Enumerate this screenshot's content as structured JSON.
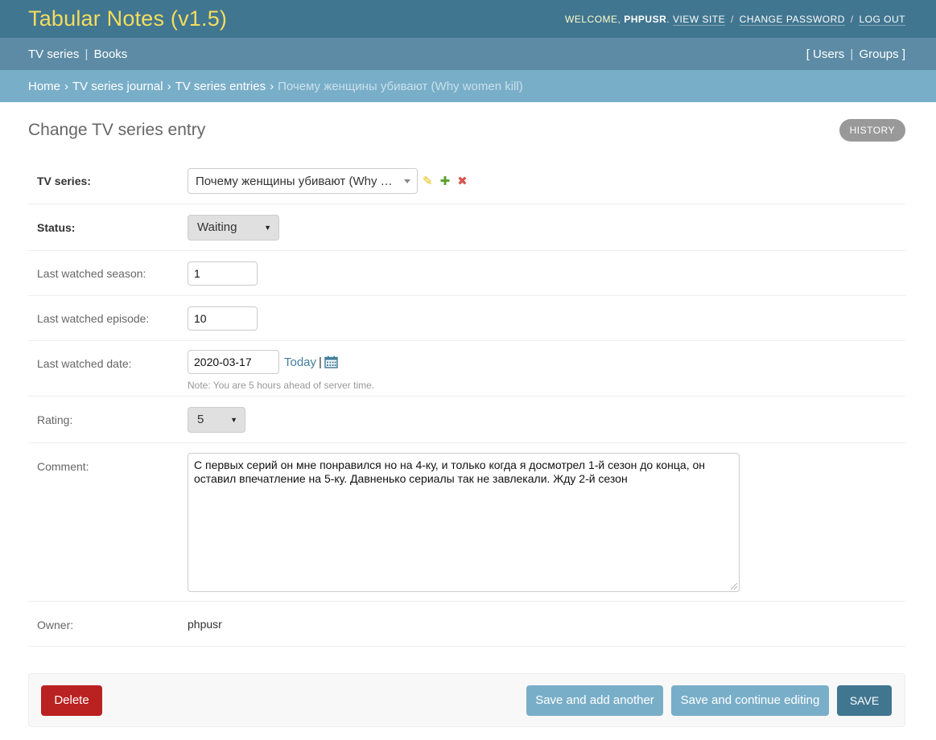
{
  "header": {
    "branding": "Tabular Notes (v1.5)",
    "welcome": "Welcome,",
    "username": "phpusr",
    "view_site": "View site",
    "change_password": "Change password",
    "log_out": "Log out"
  },
  "appbar": {
    "tv_series": "TV series",
    "books": "Books",
    "users": "Users",
    "groups": "Groups"
  },
  "breadcrumbs": {
    "home": "Home",
    "journal": "TV series journal",
    "entries": "TV series entries",
    "current": "Почему женщины убивают (Why women kill)"
  },
  "page": {
    "title": "Change TV series entry",
    "history": "History"
  },
  "form": {
    "tv_series": {
      "label": "TV series:",
      "value": "Почему женщины убивают (Why women kill)"
    },
    "status": {
      "label": "Status:",
      "value": "Waiting"
    },
    "season": {
      "label": "Last watched season:",
      "value": "1"
    },
    "episode": {
      "label": "Last watched episode:",
      "value": "10"
    },
    "date": {
      "label": "Last watched date:",
      "value": "2020-03-17",
      "today": "Today",
      "help": "Note: You are 5 hours ahead of server time."
    },
    "rating": {
      "label": "Rating:",
      "value": "5"
    },
    "comment": {
      "label": "Comment:",
      "value": "С первых серий он мне понравился но на 4-ку, и только когда я досмотрел 1-й сезон до конца, он оставил впечатление на 5-ку. Давненько сериалы так не завлекали. Жду 2-й сезон"
    },
    "owner": {
      "label": "Owner:",
      "value": "phpusr"
    }
  },
  "actions": {
    "delete": "Delete",
    "save_add_another": "Save and add another",
    "save_continue": "Save and continue editing",
    "save": "Save"
  },
  "icons": {
    "edit": "pencil-icon",
    "add": "plus-icon",
    "remove": "cross-icon",
    "calendar": "calendar-icon"
  },
  "colors": {
    "header": "#417690",
    "appbar": "#5d8ba5",
    "breadcrumbs": "#79aec8",
    "branding": "#f5dd5d",
    "delete": "#ba2121",
    "save": "#417690"
  }
}
